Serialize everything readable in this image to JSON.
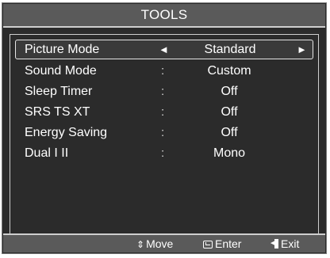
{
  "title": "TOOLS",
  "menu": {
    "rows": [
      {
        "label": "Picture Mode",
        "separator": "",
        "value": "Standard",
        "selected": true,
        "left_arrow": "◄",
        "right_arrow": "►"
      },
      {
        "label": "Sound Mode",
        "separator": ":",
        "value": "Custom",
        "selected": false
      },
      {
        "label": "Sleep Timer",
        "separator": ":",
        "value": "Off",
        "selected": false
      },
      {
        "label": "SRS TS XT",
        "separator": ":",
        "value": "Off",
        "selected": false
      },
      {
        "label": "Energy Saving",
        "separator": ":",
        "value": "Off",
        "selected": false
      },
      {
        "label": "Dual I II",
        "separator": ":",
        "value": "Mono",
        "selected": false
      }
    ]
  },
  "footer": {
    "move_icon": "⇕",
    "move_label": "Move",
    "enter_label": "Enter",
    "exit_label": "Exit"
  },
  "colors": {
    "background": "#2b2b2b",
    "title_bar": "#5a5a5a",
    "text": "#ffffff",
    "border": "#cfcfcf"
  }
}
